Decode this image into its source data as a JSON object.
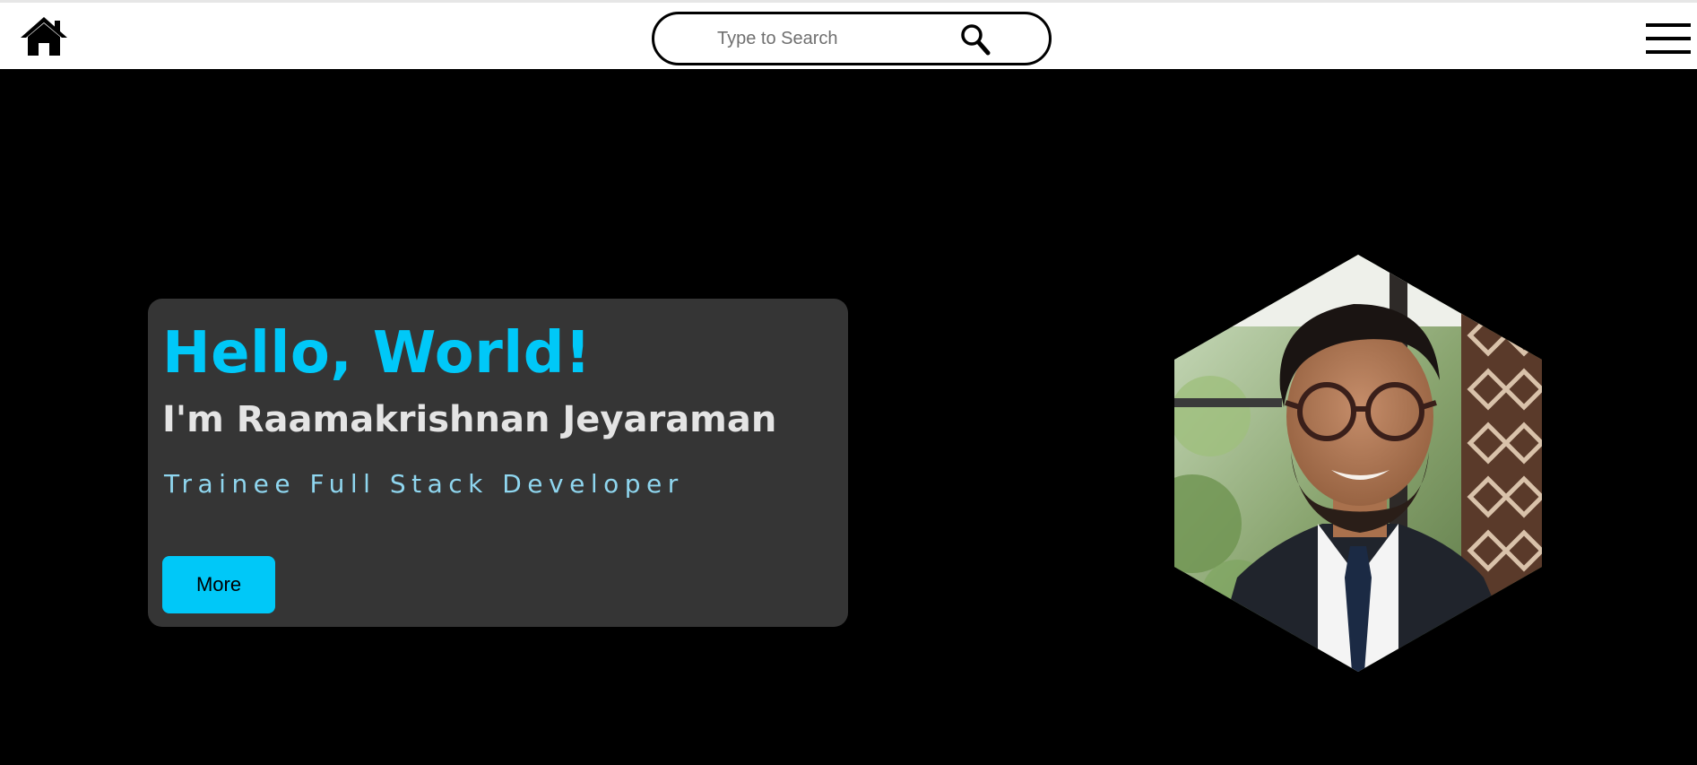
{
  "header": {
    "home_icon": "home-icon",
    "search": {
      "placeholder": "Type to Search",
      "value": "",
      "icon": "search-icon"
    },
    "menu_icon": "hamburger-menu-icon",
    "background": "#ffffff"
  },
  "hero": {
    "greeting": "Hello, World!",
    "name": "I'm Raamakrishnan Jeyaraman",
    "role": "Trainee Full Stack Developer",
    "more_label": "More",
    "photo": "profile-photo"
  },
  "colors": {
    "page_background": "#000000",
    "card_background": "#353535",
    "accent": "#00c8f8",
    "role_text": "#8fd6ef",
    "name_text": "#e4e4e4"
  }
}
